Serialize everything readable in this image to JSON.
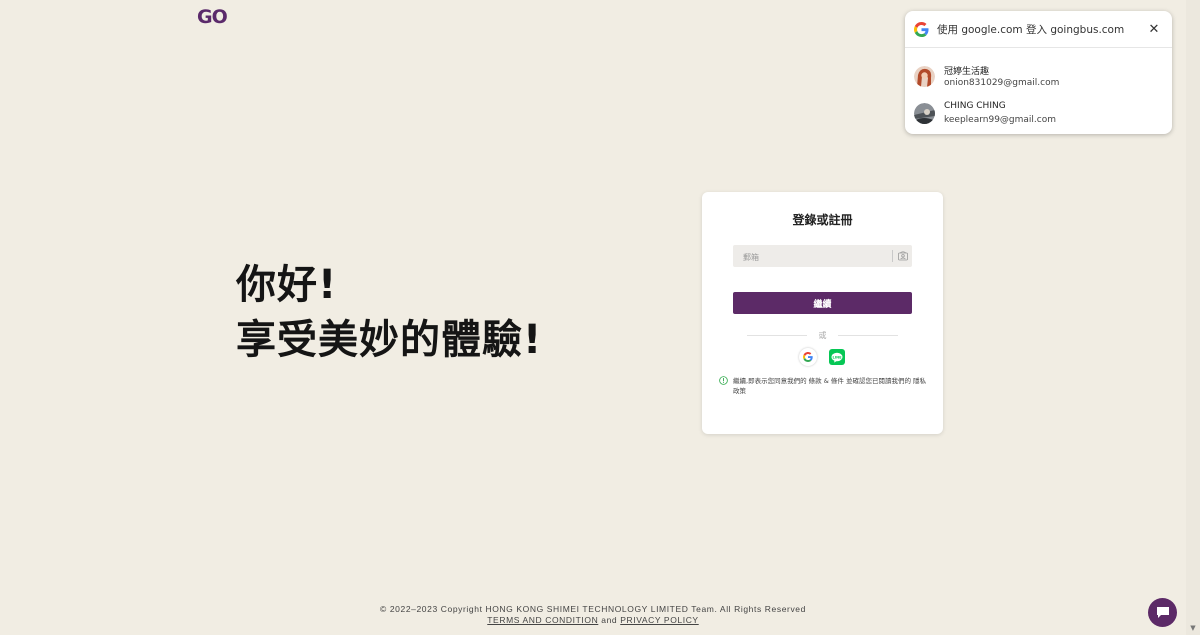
{
  "brand": {
    "logo_text": "GO",
    "color": "#5b2a6b"
  },
  "hero": {
    "line1": "你好!",
    "line2": "享受美妙的體驗!"
  },
  "login": {
    "title": "登錄或註冊",
    "email_placeholder": "郵箱",
    "email_value": "",
    "continue_label": "繼續",
    "or_label": "或",
    "terms_prefix": "繼續,即表示您同意我們的",
    "terms_link": "條款 & 條件",
    "terms_middle": "並確認您已閱讀我們的",
    "privacy_link": "隱私政策",
    "accent": "#5c2a67"
  },
  "footer": {
    "copyright": "© 2022–2023 Copyright HONG KONG SHIMEI TECHNOLOGY LIMITED Team. All Rights Reserved",
    "terms_link": "TERMS AND CONDITION",
    "and": "and",
    "privacy_link": "PRIVACY POLICY"
  },
  "google_popup": {
    "title": "使用 google.com 登入 goingbus.com",
    "close_icon": "close-icon",
    "accounts": [
      {
        "name": "冠婷生活趣",
        "email": "onion831029@gmail.com"
      },
      {
        "name": "CHING CHING",
        "email": "keeplearn99@gmail.com"
      }
    ]
  },
  "chat": {
    "icon": "chat-icon"
  }
}
